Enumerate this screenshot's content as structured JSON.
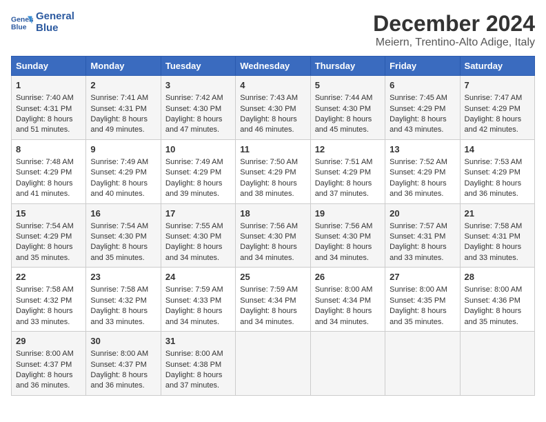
{
  "logo": {
    "line1": "General",
    "line2": "Blue"
  },
  "title": "December 2024",
  "subtitle": "Meiern, Trentino-Alto Adige, Italy",
  "days_header": [
    "Sunday",
    "Monday",
    "Tuesday",
    "Wednesday",
    "Thursday",
    "Friday",
    "Saturday"
  ],
  "weeks": [
    [
      {
        "day": "1",
        "lines": [
          "Sunrise: 7:40 AM",
          "Sunset: 4:31 PM",
          "Daylight: 8 hours",
          "and 51 minutes."
        ]
      },
      {
        "day": "2",
        "lines": [
          "Sunrise: 7:41 AM",
          "Sunset: 4:31 PM",
          "Daylight: 8 hours",
          "and 49 minutes."
        ]
      },
      {
        "day": "3",
        "lines": [
          "Sunrise: 7:42 AM",
          "Sunset: 4:30 PM",
          "Daylight: 8 hours",
          "and 47 minutes."
        ]
      },
      {
        "day": "4",
        "lines": [
          "Sunrise: 7:43 AM",
          "Sunset: 4:30 PM",
          "Daylight: 8 hours",
          "and 46 minutes."
        ]
      },
      {
        "day": "5",
        "lines": [
          "Sunrise: 7:44 AM",
          "Sunset: 4:30 PM",
          "Daylight: 8 hours",
          "and 45 minutes."
        ]
      },
      {
        "day": "6",
        "lines": [
          "Sunrise: 7:45 AM",
          "Sunset: 4:29 PM",
          "Daylight: 8 hours",
          "and 43 minutes."
        ]
      },
      {
        "day": "7",
        "lines": [
          "Sunrise: 7:47 AM",
          "Sunset: 4:29 PM",
          "Daylight: 8 hours",
          "and 42 minutes."
        ]
      }
    ],
    [
      {
        "day": "8",
        "lines": [
          "Sunrise: 7:48 AM",
          "Sunset: 4:29 PM",
          "Daylight: 8 hours",
          "and 41 minutes."
        ]
      },
      {
        "day": "9",
        "lines": [
          "Sunrise: 7:49 AM",
          "Sunset: 4:29 PM",
          "Daylight: 8 hours",
          "and 40 minutes."
        ]
      },
      {
        "day": "10",
        "lines": [
          "Sunrise: 7:49 AM",
          "Sunset: 4:29 PM",
          "Daylight: 8 hours",
          "and 39 minutes."
        ]
      },
      {
        "day": "11",
        "lines": [
          "Sunrise: 7:50 AM",
          "Sunset: 4:29 PM",
          "Daylight: 8 hours",
          "and 38 minutes."
        ]
      },
      {
        "day": "12",
        "lines": [
          "Sunrise: 7:51 AM",
          "Sunset: 4:29 PM",
          "Daylight: 8 hours",
          "and 37 minutes."
        ]
      },
      {
        "day": "13",
        "lines": [
          "Sunrise: 7:52 AM",
          "Sunset: 4:29 PM",
          "Daylight: 8 hours",
          "and 36 minutes."
        ]
      },
      {
        "day": "14",
        "lines": [
          "Sunrise: 7:53 AM",
          "Sunset: 4:29 PM",
          "Daylight: 8 hours",
          "and 36 minutes."
        ]
      }
    ],
    [
      {
        "day": "15",
        "lines": [
          "Sunrise: 7:54 AM",
          "Sunset: 4:29 PM",
          "Daylight: 8 hours",
          "and 35 minutes."
        ]
      },
      {
        "day": "16",
        "lines": [
          "Sunrise: 7:54 AM",
          "Sunset: 4:30 PM",
          "Daylight: 8 hours",
          "and 35 minutes."
        ]
      },
      {
        "day": "17",
        "lines": [
          "Sunrise: 7:55 AM",
          "Sunset: 4:30 PM",
          "Daylight: 8 hours",
          "and 34 minutes."
        ]
      },
      {
        "day": "18",
        "lines": [
          "Sunrise: 7:56 AM",
          "Sunset: 4:30 PM",
          "Daylight: 8 hours",
          "and 34 minutes."
        ]
      },
      {
        "day": "19",
        "lines": [
          "Sunrise: 7:56 AM",
          "Sunset: 4:30 PM",
          "Daylight: 8 hours",
          "and 34 minutes."
        ]
      },
      {
        "day": "20",
        "lines": [
          "Sunrise: 7:57 AM",
          "Sunset: 4:31 PM",
          "Daylight: 8 hours",
          "and 33 minutes."
        ]
      },
      {
        "day": "21",
        "lines": [
          "Sunrise: 7:58 AM",
          "Sunset: 4:31 PM",
          "Daylight: 8 hours",
          "and 33 minutes."
        ]
      }
    ],
    [
      {
        "day": "22",
        "lines": [
          "Sunrise: 7:58 AM",
          "Sunset: 4:32 PM",
          "Daylight: 8 hours",
          "and 33 minutes."
        ]
      },
      {
        "day": "23",
        "lines": [
          "Sunrise: 7:58 AM",
          "Sunset: 4:32 PM",
          "Daylight: 8 hours",
          "and 33 minutes."
        ]
      },
      {
        "day": "24",
        "lines": [
          "Sunrise: 7:59 AM",
          "Sunset: 4:33 PM",
          "Daylight: 8 hours",
          "and 34 minutes."
        ]
      },
      {
        "day": "25",
        "lines": [
          "Sunrise: 7:59 AM",
          "Sunset: 4:34 PM",
          "Daylight: 8 hours",
          "and 34 minutes."
        ]
      },
      {
        "day": "26",
        "lines": [
          "Sunrise: 8:00 AM",
          "Sunset: 4:34 PM",
          "Daylight: 8 hours",
          "and 34 minutes."
        ]
      },
      {
        "day": "27",
        "lines": [
          "Sunrise: 8:00 AM",
          "Sunset: 4:35 PM",
          "Daylight: 8 hours",
          "and 35 minutes."
        ]
      },
      {
        "day": "28",
        "lines": [
          "Sunrise: 8:00 AM",
          "Sunset: 4:36 PM",
          "Daylight: 8 hours",
          "and 35 minutes."
        ]
      }
    ],
    [
      {
        "day": "29",
        "lines": [
          "Sunrise: 8:00 AM",
          "Sunset: 4:37 PM",
          "Daylight: 8 hours",
          "and 36 minutes."
        ]
      },
      {
        "day": "30",
        "lines": [
          "Sunrise: 8:00 AM",
          "Sunset: 4:37 PM",
          "Daylight: 8 hours",
          "and 36 minutes."
        ]
      },
      {
        "day": "31",
        "lines": [
          "Sunrise: 8:00 AM",
          "Sunset: 4:38 PM",
          "Daylight: 8 hours",
          "and 37 minutes."
        ]
      },
      null,
      null,
      null,
      null
    ]
  ]
}
